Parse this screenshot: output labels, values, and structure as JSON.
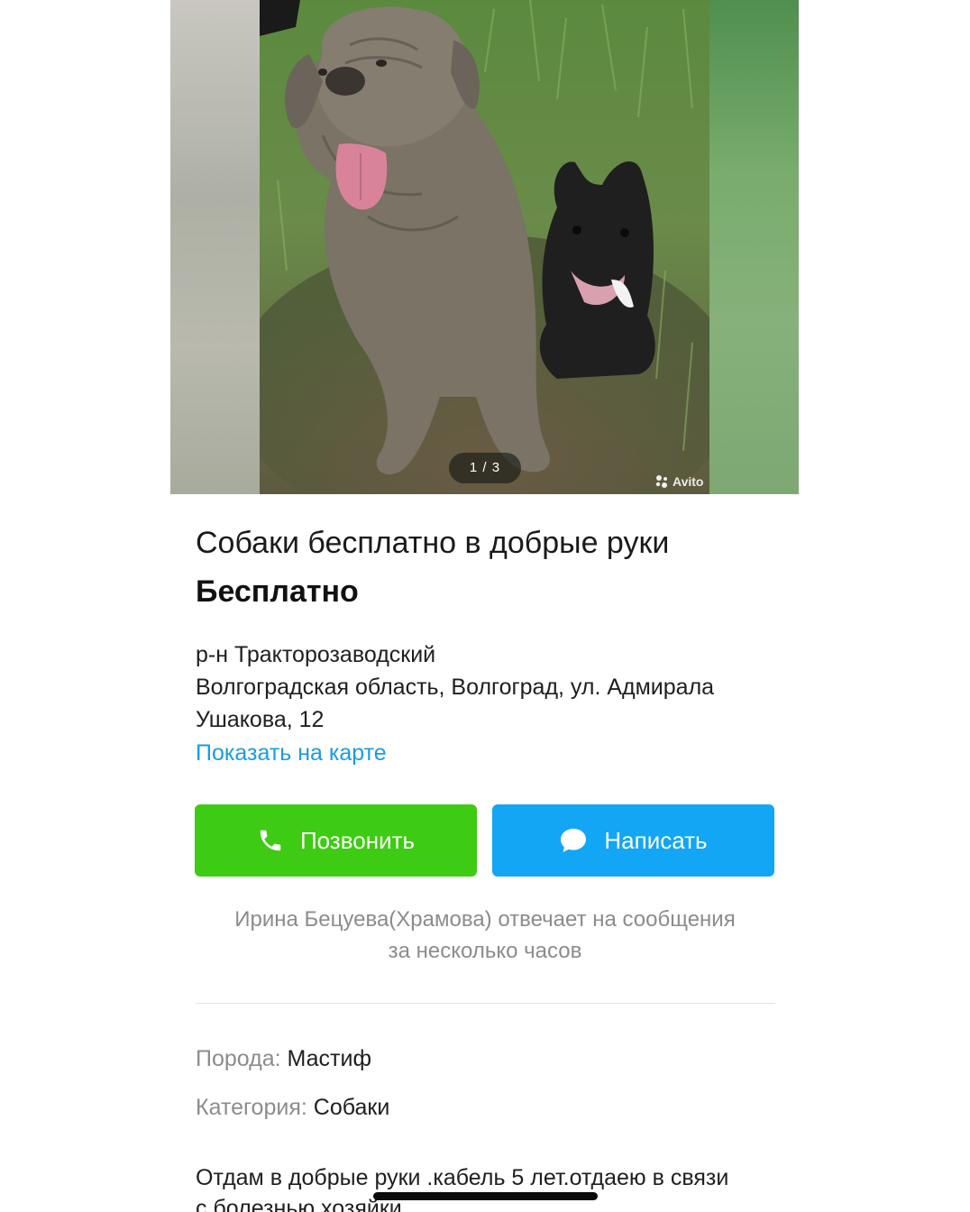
{
  "gallery": {
    "counter": "1 / 3",
    "watermark": "Avito",
    "current_photo": 1,
    "total_photos": 3
  },
  "listing": {
    "title": "Собаки бесплатно в добрые руки",
    "price": "Бесплатно",
    "district": "р-н Тракторозаводский",
    "address_line1": "Волгоградская область, Волгоград, ул. Адмирала",
    "address_line2": "Ушакова, 12",
    "map_link": "Показать на карте"
  },
  "actions": {
    "call_label": "Позвонить",
    "write_label": "Написать"
  },
  "seller_note": {
    "line1": "Ирина Бецуева(Храмова) отвечает на сообщения",
    "line2": "за несколько часов"
  },
  "params": [
    {
      "key": "Порода:",
      "value": "Мастиф"
    },
    {
      "key": "Категория:",
      "value": "Собаки"
    }
  ],
  "description": {
    "line1": "Отдам в добрые руки .кабель 5 лет.отдаею  в связи",
    "line2": "с болезнью хозяйки"
  },
  "colors": {
    "call_button": "#3ecb13",
    "write_button": "#12a6f5",
    "link": "#1a9ce0",
    "muted_text": "#8c8c8c"
  }
}
